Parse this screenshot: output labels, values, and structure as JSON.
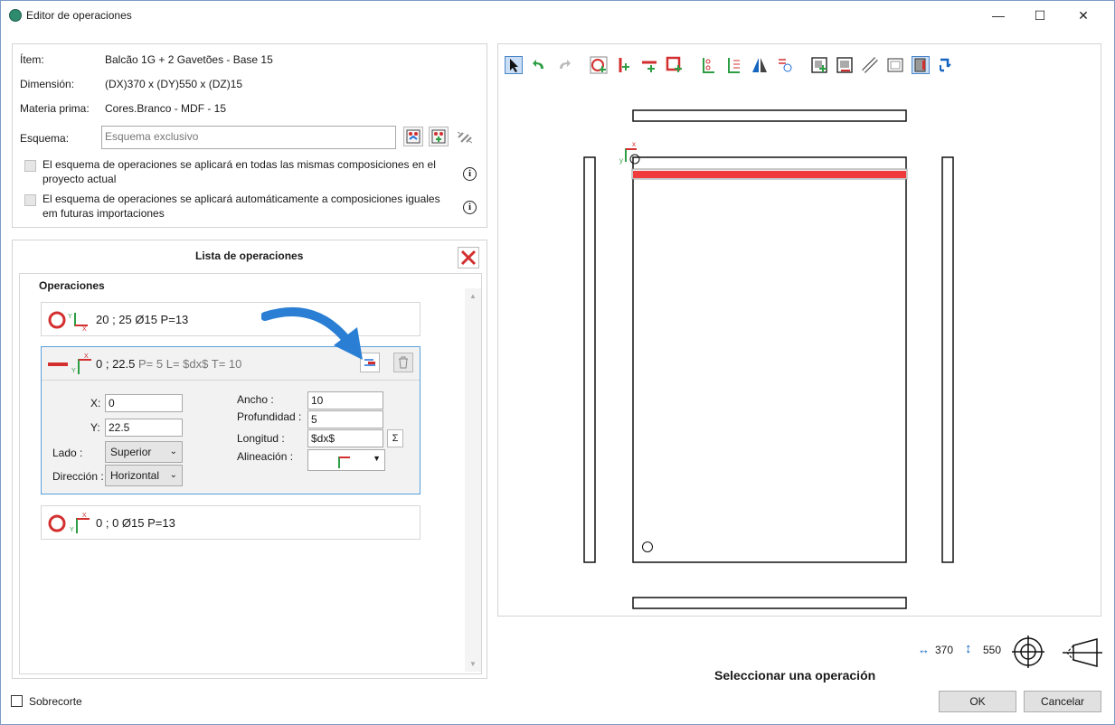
{
  "window": {
    "title": "Editor de operaciones",
    "minimize": "—",
    "maximize": "☐",
    "close": "✕"
  },
  "item": {
    "item_label": "Ítem:",
    "item_value": "Balcão 1G + 2 Gavetões - Base 15",
    "dim_label": "Dimensión:",
    "dim_value": "(DX)370 x (DY)550 x (DZ)15",
    "material_label": "Materia prima:",
    "material_value": "Cores.Branco - MDF - 15",
    "scheme_label": "Esquema:",
    "scheme_placeholder": "Esquema exclusivo",
    "check1_text_a": "El esquema de operaciones se aplicará en todas las mismas composiciones en el",
    "check1_text_b": "proyecto actual",
    "check2_text_a": "El esquema de operaciones se aplicará automáticamente a composiciones iguales",
    "check2_text_b": "em futuras importaciones",
    "info_icon": "i"
  },
  "ops_panel": {
    "title": "Lista de operaciones",
    "section": "Operaciones",
    "op1": "20 ; 25 Ø15 P=13",
    "op2": {
      "a": "0 ; 22.5",
      "b": "P= 5",
      "c": "L= $dx$",
      "d": "T= 10"
    },
    "op3": "0 ; 0 Ø15 P=13",
    "form": {
      "x_label": "X:",
      "x_value": "0",
      "y_label": "Y:",
      "y_value": "22.5",
      "side_label": "Lado :",
      "side_value": "Superior",
      "dir_label": "Dirección :",
      "dir_value": "Horizontal",
      "width_label": "Ancho :",
      "width_value": "10",
      "depth_label": "Profundidad :",
      "depth_value": "5",
      "length_label": "Longitud :",
      "length_value": "$dx$",
      "align_label": "Alineación :",
      "sigma": "Σ"
    }
  },
  "canvas": {
    "dim_x": "370",
    "dim_y": "550",
    "status": "Seleccionar una operación"
  },
  "footer": {
    "overcut": "Sobrecorte",
    "ok": "OK",
    "cancel": "Cancelar"
  },
  "colors": {
    "accent": "#3a8ee6",
    "groove": "#e53935",
    "delete": "#d32f2f"
  }
}
